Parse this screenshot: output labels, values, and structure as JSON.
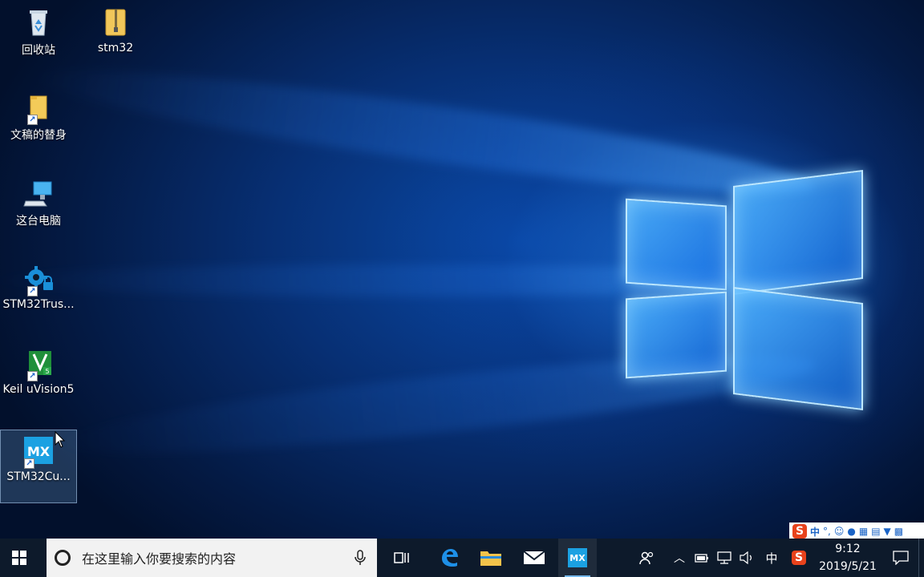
{
  "desktop": {
    "icons": [
      {
        "label": "回收站",
        "icon": "recycle-bin-icon"
      },
      {
        "label": "stm32",
        "icon": "folder-zip-icon"
      },
      {
        "label": "文稿的替身",
        "icon": "folder-shortcut-icon"
      },
      {
        "label": "这台电脑",
        "icon": "computer-icon"
      },
      {
        "label": "STM32Trus...",
        "icon": "stm32-trust-icon"
      },
      {
        "label": "Keil uVision5",
        "icon": "keil-icon"
      },
      {
        "label": "STM32Cu...",
        "icon": "stm32cubemx-icon"
      }
    ]
  },
  "taskbar": {
    "search_placeholder": "在这里输入你要搜索的内容",
    "pinned": [
      {
        "name": "task-view",
        "icon": "task-view-icon"
      },
      {
        "name": "edge",
        "icon": "edge-icon"
      },
      {
        "name": "file-explorer",
        "icon": "folder-icon"
      },
      {
        "name": "mail",
        "icon": "mail-icon"
      },
      {
        "name": "stm32cubemx",
        "icon": "mx-icon",
        "label": "MX",
        "active": true
      }
    ],
    "tray": {
      "ime_lang": "中",
      "time": "9:12",
      "date": "2019/5/21"
    }
  },
  "ime_toolbar": {
    "logo": "S",
    "lang": "中",
    "punct": "°,"
  },
  "colors": {
    "taskbar_bg": "#0d1a2b",
    "accent": "#1ba1e2",
    "mx_tile": "#1ba1e2",
    "sogou_red": "#e8421c"
  }
}
